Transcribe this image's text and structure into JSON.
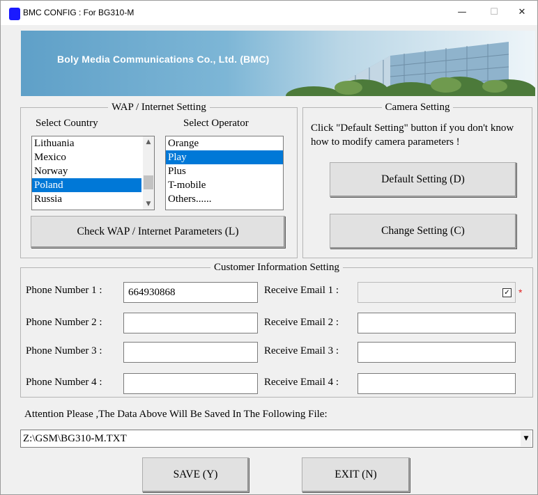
{
  "window": {
    "title": "BMC CONFIG : For BG310-M",
    "minimize_glyph": "—",
    "maximize_glyph": "☐",
    "close_glyph": "✕"
  },
  "banner": {
    "text": "Boly Media Communications Co., Ltd. (BMC)"
  },
  "wap": {
    "legend": "WAP / Internet Setting",
    "country_label": "Select Country",
    "operator_label": "Select Operator",
    "countries": [
      "Lithuania",
      "Mexico",
      "Norway",
      "Poland",
      "Russia"
    ],
    "selected_country": "Poland",
    "operators": [
      "Orange",
      "Play",
      "Plus",
      "T-mobile",
      "Others......"
    ],
    "selected_operator": "Play",
    "check_button": "Check WAP / Internet Parameters (L)"
  },
  "camera": {
    "legend": "Camera Setting",
    "hint": "Click \"Default Setting\" button if you don't know how to modify camera parameters !",
    "default_button": "Default Setting (D)",
    "change_button": "Change Setting (C)"
  },
  "customer": {
    "legend": "Customer Information Setting",
    "phone_labels": [
      "Phone Number 1 :",
      "Phone Number 2 :",
      "Phone Number 3 :",
      "Phone Number 4 :"
    ],
    "phone_values": [
      "664930868",
      "",
      "",
      ""
    ],
    "email_labels": [
      "Receive Email 1 :",
      "Receive Email 2 :",
      "Receive Email 3 :",
      "Receive Email 4 :"
    ],
    "email_values": [
      "",
      "",
      "",
      ""
    ],
    "email1_checkbox_checked": true,
    "checkbox_glyph": "✓",
    "required_mark": "*"
  },
  "attention": {
    "text": "Attention Please ,The Data Above Will Be Saved In The Following  File:",
    "file_path": "Z:\\GSM\\BG310-M.TXT"
  },
  "footer": {
    "save_button": "SAVE (Y)",
    "exit_button": "EXIT (N)"
  },
  "colors": {
    "selection": "#0078d7",
    "required_mark": "#e02020",
    "app_icon": "#1a1aff"
  }
}
